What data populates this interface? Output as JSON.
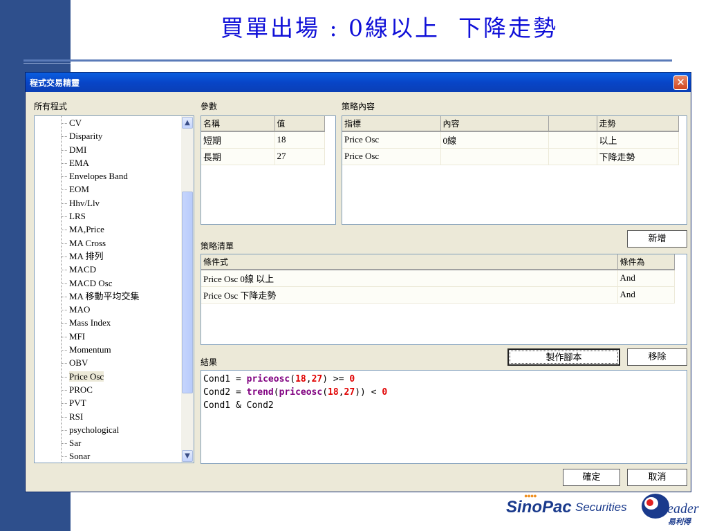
{
  "slide": {
    "title": "買單出場 : 0線以上  下降走勢"
  },
  "window": {
    "title": "程式交易精靈",
    "close_label": "✕"
  },
  "labels": {
    "all_programs": "所有程式",
    "params": "參數",
    "strategy_content": "策略內容",
    "strategy_list": "策略清單",
    "result": "結果"
  },
  "programs": [
    "CV",
    "Disparity",
    "DMI",
    "EMA",
    "Envelopes Band",
    "EOM",
    "Hhv/Llv",
    "LRS",
    "MA,Price",
    "MA Cross",
    "MA 排列",
    "MACD",
    "MACD Osc",
    "MA 移動平均交集",
    "MAO",
    "Mass Index",
    "MFI",
    "Momentum",
    "OBV",
    "Price Osc",
    "PROC",
    "PVT",
    "RSI",
    "psychological",
    "Sar",
    "Sonar"
  ],
  "selected_program": "Price Osc",
  "params": {
    "headers": [
      "名稱",
      "值"
    ],
    "rows": [
      [
        "短期",
        "18"
      ],
      [
        "長期",
        "27"
      ]
    ]
  },
  "content": {
    "headers": [
      "指標",
      "內容",
      "",
      "走勢"
    ],
    "rows": [
      [
        "Price Osc",
        "0線",
        "",
        "以上"
      ],
      [
        "Price Osc",
        "",
        "",
        "下降走勢"
      ]
    ]
  },
  "strategy_list": {
    "headers": [
      "條件式",
      "條件為"
    ],
    "rows": [
      [
        "Price Osc 0線 以上",
        "And"
      ],
      [
        "Price Osc 下降走勢",
        "And"
      ]
    ]
  },
  "buttons": {
    "add": "新增",
    "make_script": "製作腳本",
    "remove": "移除",
    "ok": "確定",
    "cancel": "取消"
  },
  "result_code": {
    "line1": {
      "a": "Cond1 = ",
      "fn": "priceosc",
      "p1": "(",
      "n1": "18",
      "c": ",",
      "n2": "27",
      "p2": ") >= ",
      "n3": "0"
    },
    "line2": {
      "a": "Cond2 = ",
      "fn1": "trend",
      "p0": "(",
      "fn2": "priceosc",
      "p1": "(",
      "n1": "18",
      "c": ",",
      "n2": "27",
      "p2": ")) < ",
      "n3": "0"
    },
    "line3": "Cond1 & Cond2"
  },
  "branding": {
    "company": "SinoPac",
    "suffix": "Securities",
    "leader": "Leader",
    "leader_cn": "易利得"
  },
  "colors": {
    "slide_band": "#2e4f8c",
    "title": "#1010d8",
    "keyword": "#800080",
    "number": "#e00000"
  }
}
